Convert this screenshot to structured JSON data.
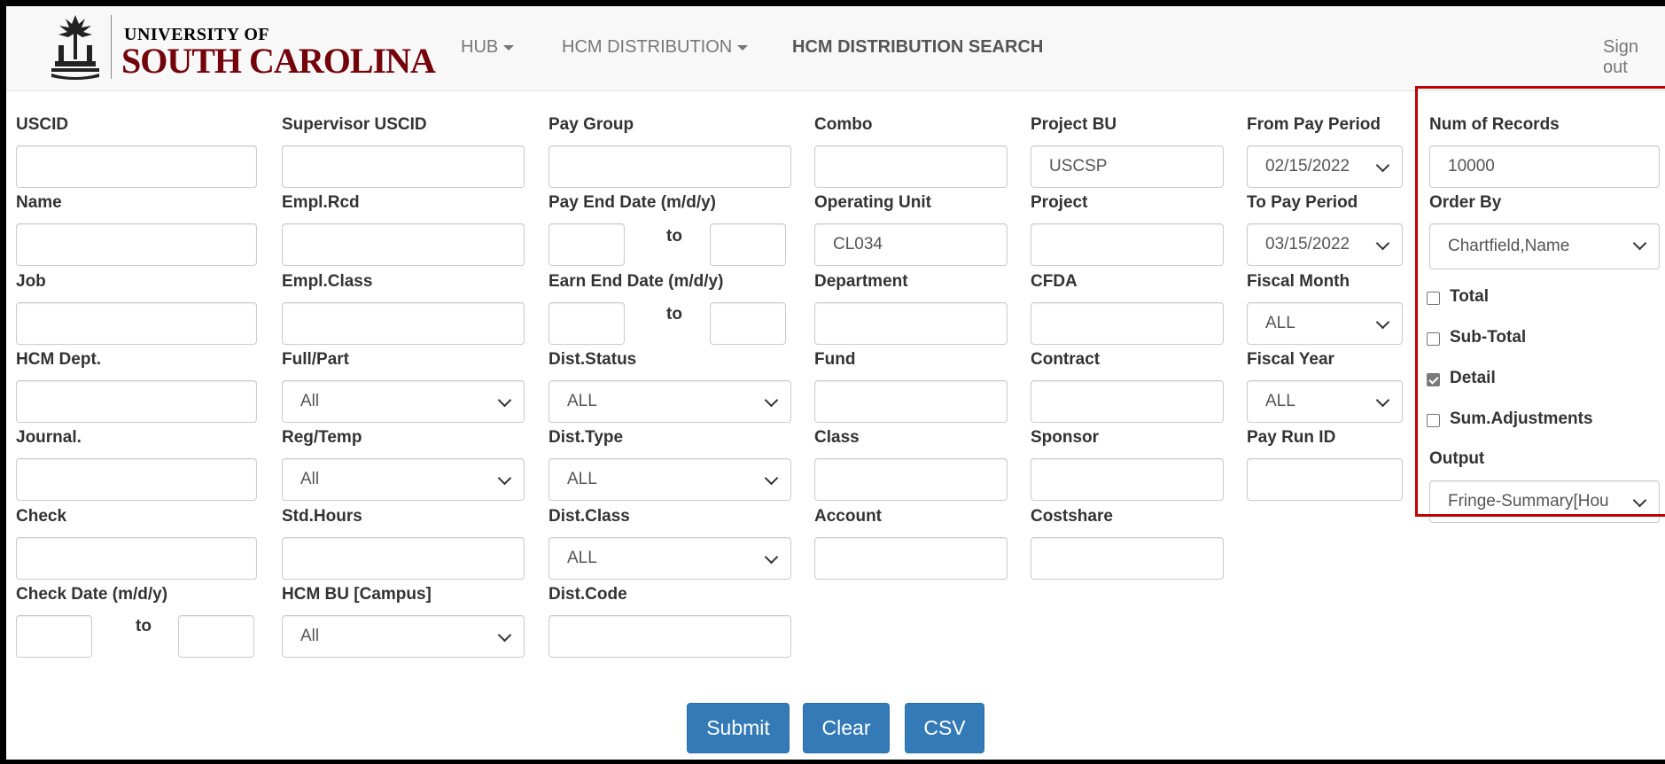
{
  "navbar": {
    "logo_top": "UNIVERSITY OF",
    "logo_bottom": "SOUTH CAROLINA",
    "hub": "HUB",
    "hcm_distribution": "HCM DISTRIBUTION",
    "hcm_distribution_search": "HCM DISTRIBUTION SEARCH",
    "sign_out": "Sign out"
  },
  "fields": {
    "uscid": {
      "label": "USCID",
      "value": ""
    },
    "name": {
      "label": "Name",
      "value": ""
    },
    "job": {
      "label": "Job",
      "value": ""
    },
    "hcm_dept": {
      "label": "HCM Dept.",
      "value": ""
    },
    "journal": {
      "label": "Journal.",
      "value": ""
    },
    "check": {
      "label": "Check",
      "value": ""
    },
    "check_date": {
      "label": "Check Date (m/d/y)",
      "to": "to",
      "from_value": "",
      "to_value": ""
    },
    "supervisor_uscid": {
      "label": "Supervisor USCID",
      "value": ""
    },
    "empl_rcd": {
      "label": "Empl.Rcd",
      "value": ""
    },
    "empl_class": {
      "label": "Empl.Class",
      "value": ""
    },
    "full_part": {
      "label": "Full/Part",
      "value": "All"
    },
    "reg_temp": {
      "label": "Reg/Temp",
      "value": "All"
    },
    "std_hours": {
      "label": "Std.Hours",
      "value": ""
    },
    "hcm_bu": {
      "label": "HCM BU [Campus]",
      "value": "All"
    },
    "pay_group": {
      "label": "Pay Group",
      "value": ""
    },
    "pay_end_date": {
      "label": "Pay End Date (m/d/y)",
      "to": "to",
      "from_value": "",
      "to_value": ""
    },
    "earn_end_date": {
      "label": "Earn End Date (m/d/y)",
      "to": "to",
      "from_value": "",
      "to_value": ""
    },
    "dist_status": {
      "label": "Dist.Status",
      "value": "ALL"
    },
    "dist_type": {
      "label": "Dist.Type",
      "value": "ALL"
    },
    "dist_class": {
      "label": "Dist.Class",
      "value": "ALL"
    },
    "dist_code": {
      "label": "Dist.Code",
      "value": ""
    },
    "combo": {
      "label": "Combo",
      "value": ""
    },
    "operating_unit": {
      "label": "Operating Unit",
      "value": "CL034"
    },
    "department": {
      "label": "Department",
      "value": ""
    },
    "fund": {
      "label": "Fund",
      "value": ""
    },
    "class": {
      "label": "Class",
      "value": ""
    },
    "account": {
      "label": "Account",
      "value": ""
    },
    "project_bu": {
      "label": "Project BU",
      "value": "USCSP"
    },
    "project": {
      "label": "Project",
      "value": ""
    },
    "cfda": {
      "label": "CFDA",
      "value": ""
    },
    "contract": {
      "label": "Contract",
      "value": ""
    },
    "sponsor": {
      "label": "Sponsor",
      "value": ""
    },
    "costshare": {
      "label": "Costshare",
      "value": ""
    },
    "from_pay_period": {
      "label": "From Pay Period",
      "value": "02/15/2022"
    },
    "to_pay_period": {
      "label": "To Pay Period",
      "value": "03/15/2022"
    },
    "fiscal_month": {
      "label": "Fiscal Month",
      "value": "ALL"
    },
    "fiscal_year": {
      "label": "Fiscal Year",
      "value": "ALL"
    },
    "pay_run_id": {
      "label": "Pay Run ID",
      "value": ""
    },
    "num_records": {
      "label": "Num of Records",
      "value": "10000"
    },
    "order_by": {
      "label": "Order By",
      "value": "Chartfield,Name"
    },
    "output": {
      "label": "Output",
      "value": "Fringe-Summary[Hou"
    }
  },
  "options": {
    "total": {
      "label": "Total",
      "checked": false
    },
    "sub_total": {
      "label": "Sub-Total",
      "checked": false
    },
    "detail": {
      "label": "Detail",
      "checked": true
    },
    "sum_adjustments": {
      "label": "Sum.Adjustments",
      "checked": false
    }
  },
  "buttons": {
    "submit": "Submit",
    "clear": "Clear",
    "csv": "CSV"
  },
  "colors": {
    "brand": "#73000a",
    "primary_button": "#337ab7",
    "highlight": "#c00000"
  }
}
